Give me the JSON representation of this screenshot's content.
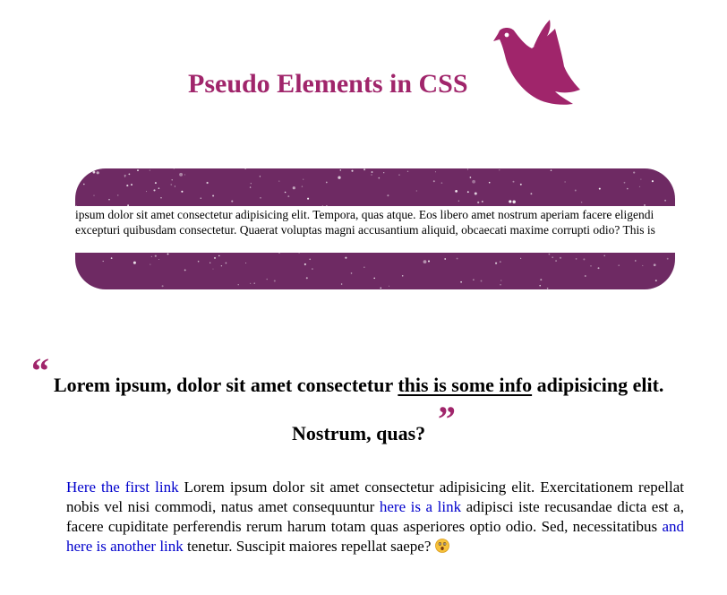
{
  "colors": {
    "accent": "#a0256b",
    "banner_bg": "#6e2a63",
    "link": "#0000cc"
  },
  "header": {
    "title": "Pseudo Elements in CSS",
    "logo_icon": "bird-icon"
  },
  "banner": {
    "text": "ipsum dolor sit amet consectetur adipisicing elit. Tempora, quas atque. Eos libero amet nostrum aperiam facere eligendi excepturi quibusdam consectetur. Quaerat voluptas magni accusantium aliquid, obcaecati maxime corrupti odio? This is"
  },
  "quote": {
    "open_mark": "“",
    "close_mark": "”",
    "line1_before": "Lorem ipsum, dolor sit amet consectetur ",
    "info_text": "this is some info",
    "line1_after": " adipisicing elit.",
    "line2": "Nostrum, quas?"
  },
  "paragraph": {
    "link1": "Here the first link",
    "text1": " Lorem ipsum dolor sit amet consectetur adipisicing elit. Exercitationem repellat nobis vel nisi commodi, natus amet consequuntur ",
    "link2": "here is a link",
    "text2": " adipisci iste recusandae dicta est a, facere cupiditate perferendis rerum harum totam quas asperiores optio odio. Sed, necessitatibus ",
    "link3": "and here is another link",
    "text3": " tenetur. Suscipit maiores repellat saepe? ",
    "emoji_icon": "astonished-face-icon"
  }
}
